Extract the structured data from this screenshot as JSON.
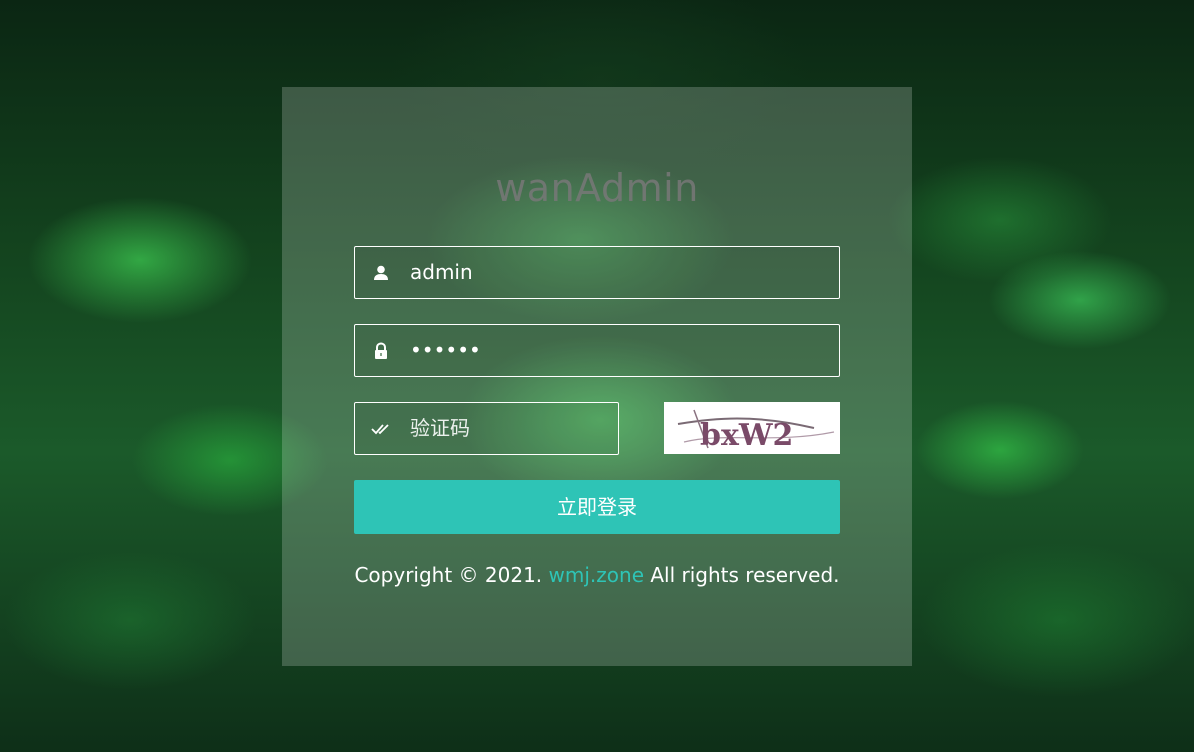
{
  "app": {
    "title": "wanAdmin"
  },
  "form": {
    "username": {
      "value": "admin",
      "icon": "user-icon"
    },
    "password": {
      "value": "••••••",
      "icon": "lock-icon"
    },
    "captcha": {
      "placeholder": "验证码",
      "icon": "double-check-icon",
      "image_text": "bxW2"
    },
    "submit_label": "立即登录"
  },
  "footer": {
    "prefix": "Copyright © 2021.",
    "link_text": "wmj.zone",
    "suffix": "All rights reserved."
  },
  "colors": {
    "accent": "#2ec4b6",
    "panel": "rgba(255,255,255,0.20)",
    "field_border": "#ffffff"
  }
}
